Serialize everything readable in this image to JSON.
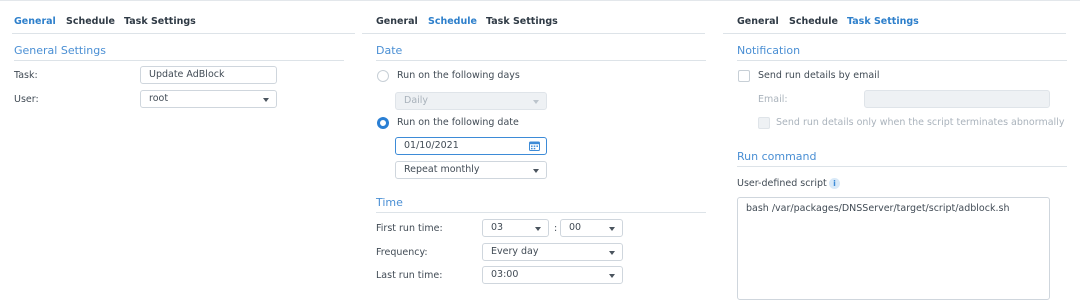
{
  "tabs": {
    "general": "General",
    "schedule": "Schedule",
    "task_settings": "Task Settings"
  },
  "general": {
    "heading": "General Settings",
    "task_label": "Task:",
    "task_value": "Update AdBlock",
    "user_label": "User:",
    "user_value": "root"
  },
  "schedule": {
    "date_heading": "Date",
    "run_days_label": "Run on the following days",
    "days_value": "Daily",
    "run_date_label": "Run on the following date",
    "date_value": "01/10/2021",
    "repeat_value": "Repeat monthly",
    "time_heading": "Time",
    "first_run_label": "First run time:",
    "first_run_hour": "03",
    "time_separator": ":",
    "first_run_minute": "00",
    "frequency_label": "Frequency:",
    "frequency_value": "Every day",
    "last_run_label": "Last run time:",
    "last_run_value": "03:00",
    "selected_option": "run_on_date"
  },
  "task_settings": {
    "notification_heading": "Notification",
    "send_email_label": "Send run details by email",
    "email_label": "Email:",
    "email_value": "",
    "abnormal_label": "Send run details only when the script terminates abnormally",
    "run_command_heading": "Run command",
    "script_label": "User-defined script",
    "info_glyph": "i",
    "script_value": "bash /var/packages/DNSServer/target/script/adblock.sh"
  },
  "colors": {
    "accent": "#2d7fcb",
    "heading": "#4a8fd4",
    "radio_checked": "#2a7fd4"
  },
  "icons": {
    "calendar": "calendar-icon",
    "info": "info-icon",
    "dropdown": "chevron-down-icon"
  }
}
